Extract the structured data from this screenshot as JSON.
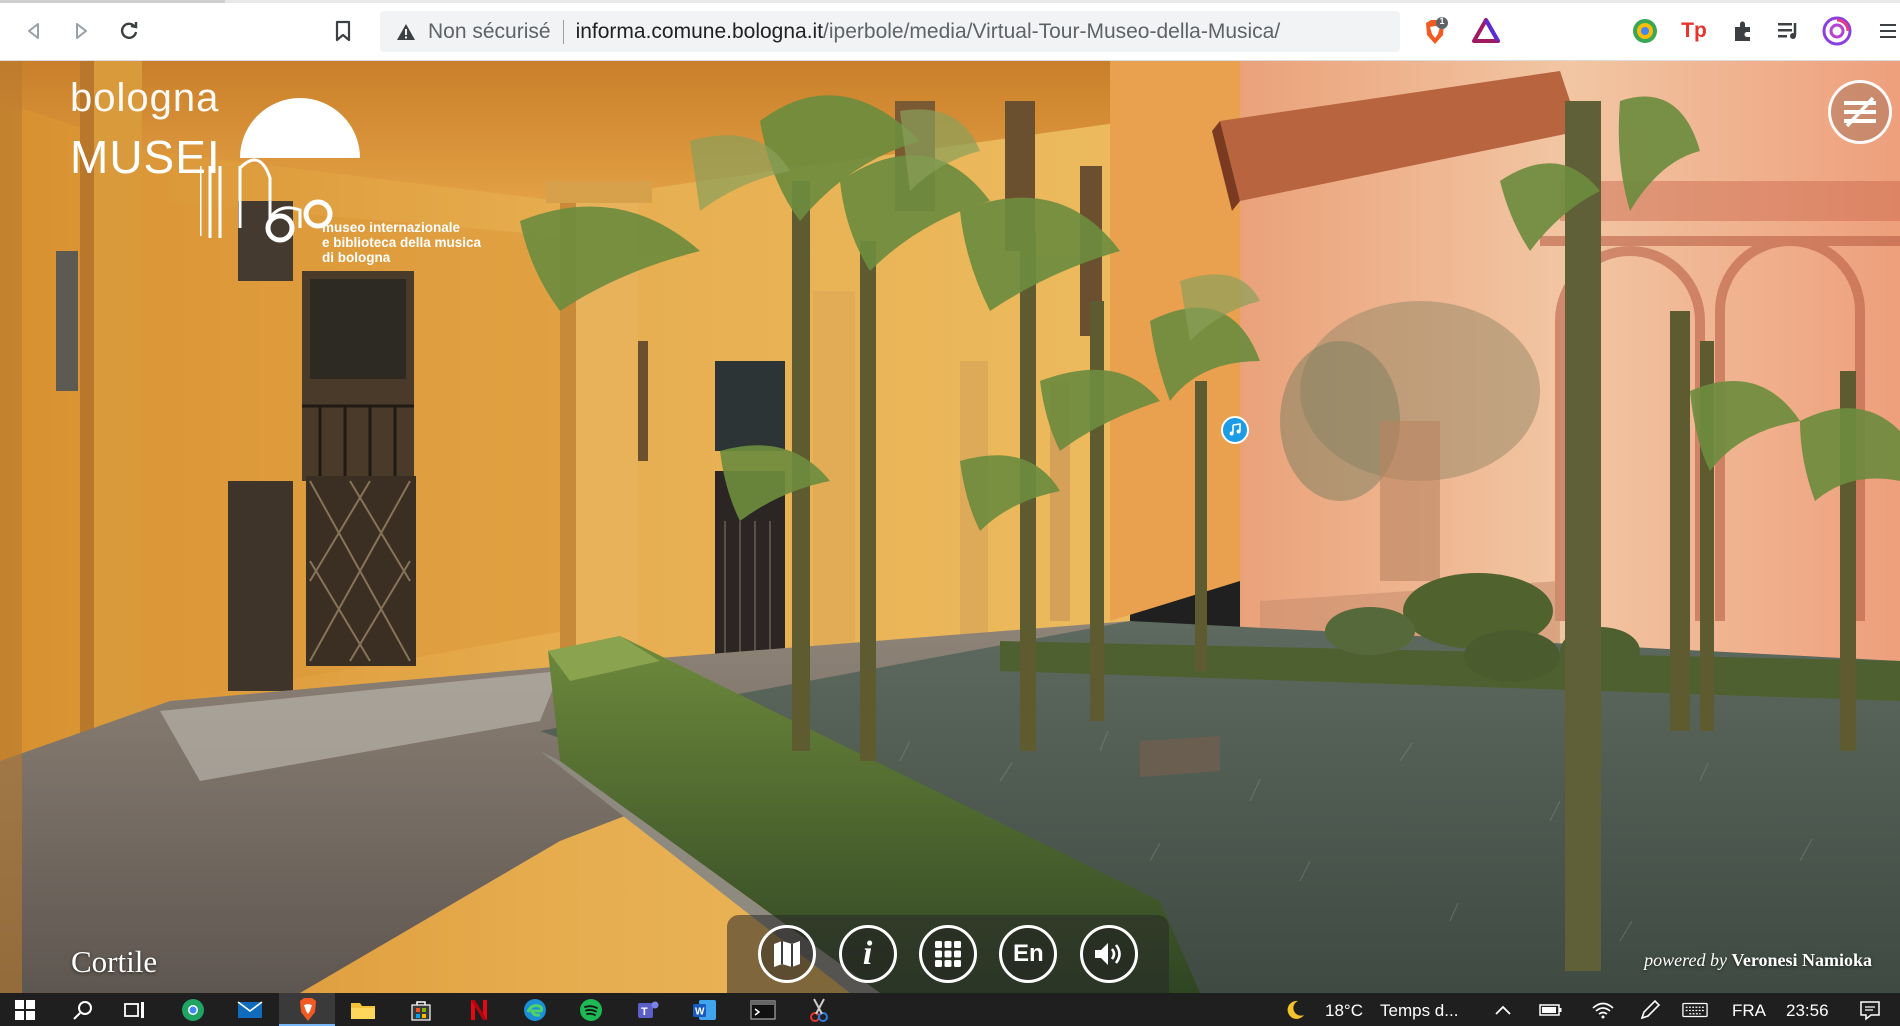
{
  "browser": {
    "security_label": "Non sécurisé",
    "url_host": "informa.comune.bologna.it",
    "url_path": "/iperbole/media/Virtual-Tour-Museo-della-Musica/",
    "brave_badge_count": "1",
    "icons": {
      "back": "back-icon",
      "forward": "forward-icon",
      "reload": "reload-icon",
      "bookmark": "bookmark-icon",
      "warning": "warning-icon",
      "brave_shield": "brave-shield-icon",
      "brave_rewards": "brave-rewards-icon"
    },
    "extensions": [
      "extension-color-icon",
      "extension-tp-icon",
      "extensions-puzzle-icon",
      "playlist-icon",
      "profile-icon",
      "menu-icon"
    ],
    "tp_label": "Tp"
  },
  "museum": {
    "city": "bologna",
    "musei": "MUSEI",
    "subtitle_lines": [
      "museo internazionale",
      "e biblioteca della musica",
      "di bologna"
    ]
  },
  "scene": {
    "title": "Cortile",
    "powered_prefix": "powered by",
    "powered_name": "Veronesi Namioka"
  },
  "controls": {
    "map": "map-icon",
    "info": "i",
    "grid": "grid-icon",
    "language": "En",
    "audio": "volume-icon",
    "menu": "menu-toggle-icon",
    "hotspot": "music-note-icon"
  },
  "taskbar": {
    "weather_temp": "18°C",
    "weather_text": "Temps d...",
    "language": "FRA",
    "time": "23:56"
  },
  "colors": {
    "hotspot": "#1c9be6",
    "wall_ochre": "#e2a64a",
    "taskbar": "#1f1f1f"
  }
}
